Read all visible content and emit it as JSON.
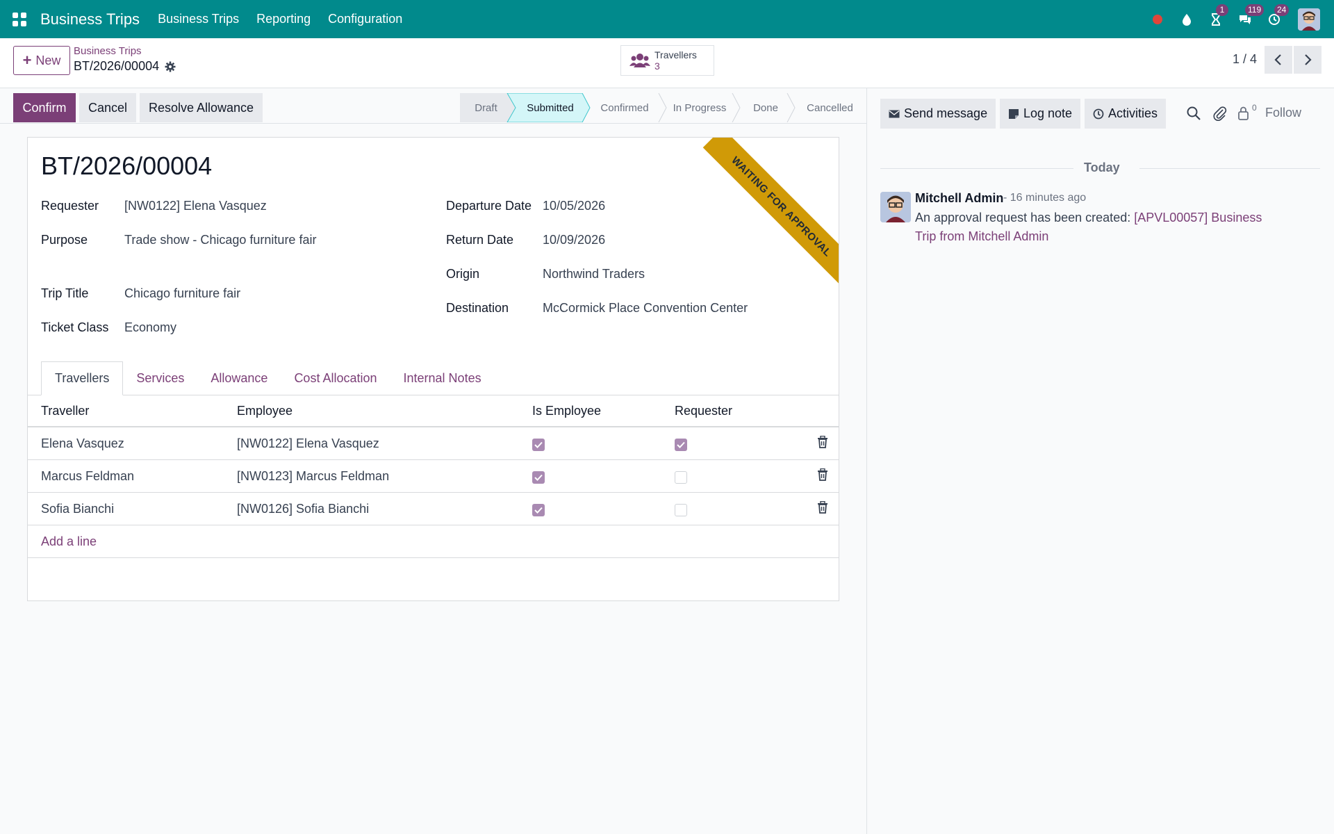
{
  "navbar": {
    "brand": "Business Trips",
    "menus": [
      "Business Trips",
      "Reporting",
      "Configuration"
    ],
    "activity_badge": "1",
    "messages_badge": "119",
    "clock_badge": "24",
    "color": "#018a8c"
  },
  "control": {
    "new_label": "New",
    "breadcrumb_parent": "Business Trips",
    "breadcrumb_current": "BT/2026/00004",
    "smart_button": {
      "label": "Travellers",
      "value": "3"
    },
    "pager": "1 / 4"
  },
  "statusbar": {
    "confirm": "Confirm",
    "cancel": "Cancel",
    "resolve": "Resolve Allowance",
    "stages": [
      "Draft",
      "Submitted",
      "Confirmed",
      "In Progress",
      "Done",
      "Cancelled"
    ],
    "active_stage": "Submitted"
  },
  "record": {
    "name": "BT/2026/00004",
    "ribbon": "Waiting for approval",
    "requester_label": "Requester",
    "requester": "[NW0122] Elena Vasquez",
    "purpose_label": "Purpose",
    "purpose": "Trade show - Chicago furniture fair",
    "trip_title_label": "Trip Title",
    "trip_title": "Chicago furniture fair",
    "ticket_class_label": "Ticket Class",
    "ticket_class": "Economy",
    "departure_label": "Departure Date",
    "departure": "10/05/2026",
    "return_label": "Return Date",
    "return": "10/09/2026",
    "origin_label": "Origin",
    "origin": "Northwind Traders",
    "destination_label": "Destination",
    "destination": "McCormick Place Convention Center"
  },
  "tabs": [
    "Travellers",
    "Services",
    "Allowance",
    "Cost Allocation",
    "Internal Notes"
  ],
  "table": {
    "headers": [
      "Traveller",
      "Employee",
      "Is Employee",
      "Requester"
    ],
    "rows": [
      {
        "traveller": "Elena Vasquez",
        "employee": "[NW0122] Elena Vasquez",
        "is_employee": true,
        "requester": true
      },
      {
        "traveller": "Marcus Feldman",
        "employee": "[NW0123] Marcus Feldman",
        "is_employee": true,
        "requester": false
      },
      {
        "traveller": "Sofia Bianchi",
        "employee": "[NW0126] Sofia Bianchi",
        "is_employee": true,
        "requester": false
      }
    ],
    "add_line": "Add a line"
  },
  "chatter": {
    "send_message": "Send message",
    "log_note": "Log note",
    "activities": "Activities",
    "follower_count": "0",
    "follow": "Follow",
    "day_separator": "Today",
    "message": {
      "author": "Mitchell Admin",
      "time": "- 16 minutes ago",
      "text": "An approval request has been created: ",
      "link": "[APVL00057] Business Trip from Mitchell Admin"
    }
  }
}
